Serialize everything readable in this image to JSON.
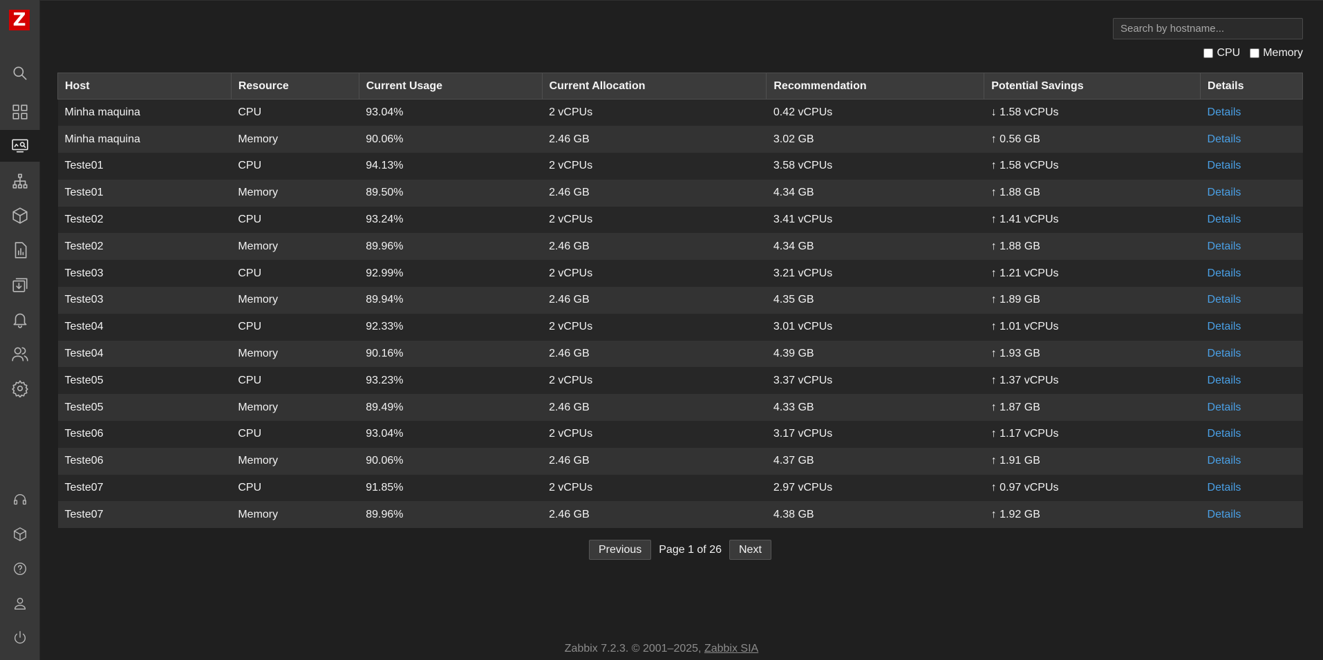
{
  "app": {
    "logo_letter": "Z",
    "brand_color": "#d40000",
    "link_color": "#4aa0e6"
  },
  "sidebar": {
    "icons": [
      "search-icon",
      "dashboard-icon",
      "monitoring-icon",
      "network-icon",
      "inventory-icon",
      "reports-icon",
      "data-collection-icon",
      "alerts-icon",
      "users-icon",
      "settings-icon",
      "support-icon",
      "integrations-icon",
      "help-icon",
      "user-settings-icon",
      "sign-out-icon"
    ],
    "active": "monitoring-icon"
  },
  "search": {
    "placeholder": "Search by hostname...",
    "value": ""
  },
  "filters": {
    "cpu_label": "CPU",
    "memory_label": "Memory",
    "cpu_checked": false,
    "memory_checked": false
  },
  "table": {
    "columns": [
      "Host",
      "Resource",
      "Current Usage",
      "Current Allocation",
      "Recommendation",
      "Potential Savings",
      "Details"
    ],
    "rows": [
      [
        "Minha maquina",
        "CPU",
        "93.04%",
        "2 vCPUs",
        "0.42 vCPUs",
        "↓ 1.58 vCPUs",
        "Details"
      ],
      [
        "Minha maquina",
        "Memory",
        "90.06%",
        "2.46 GB",
        "3.02 GB",
        "↑ 0.56 GB",
        "Details"
      ],
      [
        "Teste01",
        "CPU",
        "94.13%",
        "2 vCPUs",
        "3.58 vCPUs",
        "↑ 1.58 vCPUs",
        "Details"
      ],
      [
        "Teste01",
        "Memory",
        "89.50%",
        "2.46 GB",
        "4.34 GB",
        "↑ 1.88 GB",
        "Details"
      ],
      [
        "Teste02",
        "CPU",
        "93.24%",
        "2 vCPUs",
        "3.41 vCPUs",
        "↑ 1.41 vCPUs",
        "Details"
      ],
      [
        "Teste02",
        "Memory",
        "89.96%",
        "2.46 GB",
        "4.34 GB",
        "↑ 1.88 GB",
        "Details"
      ],
      [
        "Teste03",
        "CPU",
        "92.99%",
        "2 vCPUs",
        "3.21 vCPUs",
        "↑ 1.21 vCPUs",
        "Details"
      ],
      [
        "Teste03",
        "Memory",
        "89.94%",
        "2.46 GB",
        "4.35 GB",
        "↑ 1.89 GB",
        "Details"
      ],
      [
        "Teste04",
        "CPU",
        "92.33%",
        "2 vCPUs",
        "3.01 vCPUs",
        "↑ 1.01 vCPUs",
        "Details"
      ],
      [
        "Teste04",
        "Memory",
        "90.16%",
        "2.46 GB",
        "4.39 GB",
        "↑ 1.93 GB",
        "Details"
      ],
      [
        "Teste05",
        "CPU",
        "93.23%",
        "2 vCPUs",
        "3.37 vCPUs",
        "↑ 1.37 vCPUs",
        "Details"
      ],
      [
        "Teste05",
        "Memory",
        "89.49%",
        "2.46 GB",
        "4.33 GB",
        "↑ 1.87 GB",
        "Details"
      ],
      [
        "Teste06",
        "CPU",
        "93.04%",
        "2 vCPUs",
        "3.17 vCPUs",
        "↑ 1.17 vCPUs",
        "Details"
      ],
      [
        "Teste06",
        "Memory",
        "90.06%",
        "2.46 GB",
        "4.37 GB",
        "↑ 1.91 GB",
        "Details"
      ],
      [
        "Teste07",
        "CPU",
        "91.85%",
        "2 vCPUs",
        "2.97 vCPUs",
        "↑ 0.97 vCPUs",
        "Details"
      ],
      [
        "Teste07",
        "Memory",
        "89.96%",
        "2.46 GB",
        "4.38 GB",
        "↑ 1.92 GB",
        "Details"
      ]
    ]
  },
  "pagination": {
    "prev_label": "Previous",
    "page_info": "Page 1 of 26",
    "next_label": "Next"
  },
  "footer": {
    "text": "Zabbix 7.2.3. © 2001–2025,",
    "link_text": "Zabbix SIA"
  }
}
